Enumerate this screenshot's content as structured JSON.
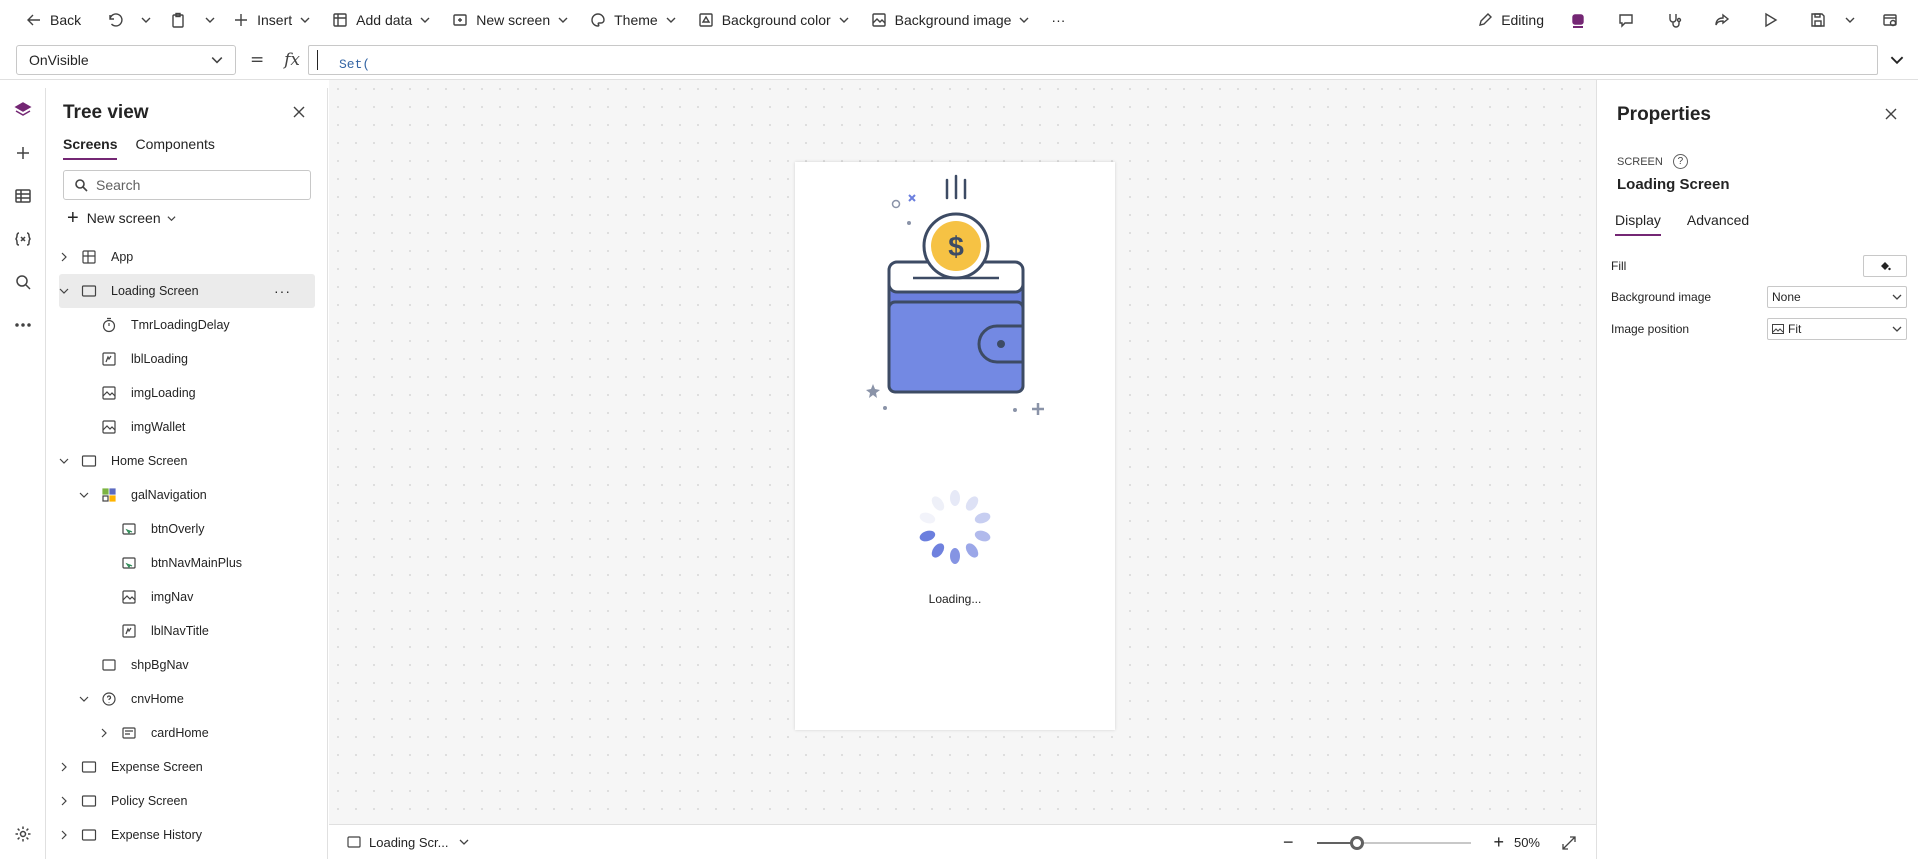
{
  "toolbar": {
    "back": "Back",
    "insert": "Insert",
    "add_data": "Add data",
    "new_screen": "New screen",
    "theme": "Theme",
    "background_color": "Background color",
    "background_image": "Background image",
    "overflow": "···",
    "editing": "Editing"
  },
  "formula": {
    "property": "OnVisible",
    "equals": "=",
    "fx": "fx",
    "value": "Set("
  },
  "tree": {
    "title": "Tree view",
    "tabs": [
      "Screens",
      "Components"
    ],
    "search_placeholder": "Search",
    "new_screen": "New screen",
    "items": [
      {
        "label": "App",
        "icon": "app-icon",
        "level": 0,
        "expand": "collapsed"
      },
      {
        "label": "Loading Screen",
        "icon": "screen-icon",
        "level": 0,
        "expand": "expanded",
        "selected": true
      },
      {
        "label": "TmrLoadingDelay",
        "icon": "timer-icon",
        "level": 1,
        "expand": "none"
      },
      {
        "label": "lblLoading",
        "icon": "label-icon",
        "level": 1,
        "expand": "none"
      },
      {
        "label": "imgLoading",
        "icon": "image-icon",
        "level": 1,
        "expand": "none"
      },
      {
        "label": "imgWallet",
        "icon": "image-icon",
        "level": 1,
        "expand": "none"
      },
      {
        "label": "Home Screen",
        "icon": "screen-icon",
        "level": 0,
        "expand": "expanded"
      },
      {
        "label": "galNavigation",
        "icon": "gallery-icon",
        "level": 1,
        "expand": "expanded"
      },
      {
        "label": "btnOverly",
        "icon": "button-icon",
        "level": 2,
        "expand": "none"
      },
      {
        "label": "btnNavMainPlus",
        "icon": "button-icon",
        "level": 2,
        "expand": "none"
      },
      {
        "label": "imgNav",
        "icon": "image-icon",
        "level": 2,
        "expand": "none"
      },
      {
        "label": "lblNavTitle",
        "icon": "label-icon",
        "level": 2,
        "expand": "none"
      },
      {
        "label": "shpBgNav",
        "icon": "rectangle-icon",
        "level": 1,
        "expand": "none"
      },
      {
        "label": "cnvHome",
        "icon": "container-icon",
        "level": 1,
        "expand": "expanded"
      },
      {
        "label": "cardHome",
        "icon": "card-icon",
        "level": 2,
        "expand": "collapsed"
      },
      {
        "label": "Expense Screen",
        "icon": "screen-icon",
        "level": 0,
        "expand": "collapsed"
      },
      {
        "label": "Policy Screen",
        "icon": "screen-icon",
        "level": 0,
        "expand": "collapsed"
      },
      {
        "label": "Expense History",
        "icon": "screen-icon",
        "level": 0,
        "expand": "collapsed"
      }
    ]
  },
  "canvas": {
    "loading_text": "Loading...",
    "status_screen": "Loading Scr...",
    "zoom_label": "50%",
    "zoom_fraction": 0.26
  },
  "properties": {
    "title": "Properties",
    "type_label": "SCREEN",
    "help": "?",
    "screen_name": "Loading Screen",
    "tabs": [
      "Display",
      "Advanced"
    ],
    "fill_label": "Fill",
    "bg_image_label": "Background image",
    "bg_image_value": "None",
    "image_position_label": "Image position",
    "image_position_value": "Fit"
  },
  "colors": {
    "accent": "#742774",
    "wallet": "#6b7fde",
    "coin": "#f6c244",
    "outline": "#3d4b64"
  }
}
